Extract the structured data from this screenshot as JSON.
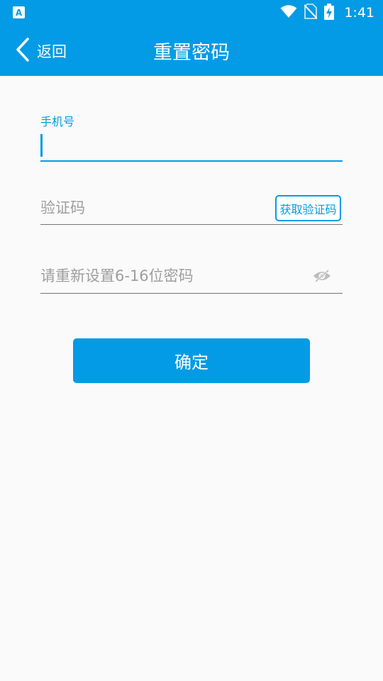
{
  "status_bar": {
    "app_icon_letter": "A",
    "time": "1:41",
    "icons": [
      "wifi-icon",
      "no-sim-icon",
      "battery-charging-icon"
    ]
  },
  "app_bar": {
    "back_label": "返回",
    "title": "重置密码"
  },
  "form": {
    "phone": {
      "label": "手机号",
      "value": ""
    },
    "code": {
      "placeholder": "验证码",
      "value": "",
      "get_code_label": "获取验证码"
    },
    "password": {
      "placeholder": "请重新设置6-16位密码",
      "value": "",
      "toggle_icon": "eye-hidden-icon"
    },
    "confirm_label": "确定"
  },
  "colors": {
    "primary": "#039be5",
    "background": "#fafafa",
    "underline_inactive": "#757575",
    "placeholder": "#9e9e9e"
  }
}
